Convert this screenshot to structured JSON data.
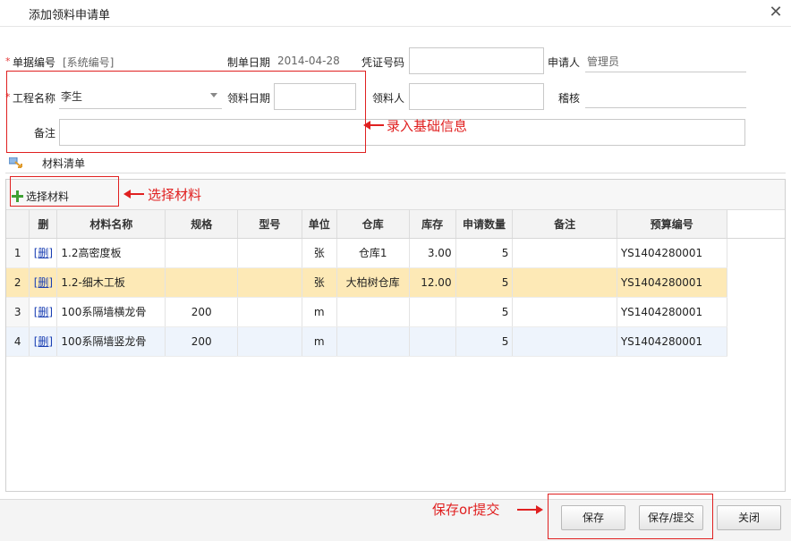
{
  "dialog": {
    "title": "添加领料申请单"
  },
  "form": {
    "doc_no": {
      "label": "单据编号",
      "value": "[系统编号]"
    },
    "date": {
      "label": "制单日期",
      "value": "2014-04-28"
    },
    "voucher": {
      "label": "凭证号码",
      "value": ""
    },
    "applicant": {
      "label": "申请人",
      "value": "管理员"
    },
    "project": {
      "label": "工程名称",
      "value": "李生"
    },
    "pick_date": {
      "label": "领料日期",
      "value": ""
    },
    "picker": {
      "label": "领料人",
      "value": ""
    },
    "audit": {
      "label": "稽核",
      "value": ""
    },
    "remark": {
      "label": "备注",
      "value": ""
    }
  },
  "annotations": {
    "basic_info": "录入基础信息",
    "select_material": "选择材料",
    "save_submit": "保存or提交"
  },
  "section": {
    "title": "材料清单"
  },
  "toolbar": {
    "select_material": "选择材料"
  },
  "table": {
    "columns": [
      "",
      "删",
      "材料名称",
      "规格",
      "型号",
      "单位",
      "仓库",
      "库存",
      "申请数量",
      "备注",
      "预算编号"
    ],
    "rows": [
      {
        "idx": "1",
        "del": "[删]",
        "name": "1.2高密度板",
        "spec": "",
        "model": "",
        "unit": "张",
        "warehouse": "仓库1",
        "stock": "3.00",
        "qty": "5",
        "remark": "",
        "budget": "YS1404280001"
      },
      {
        "idx": "2",
        "del": "[删]",
        "name": "1.2-细木工板",
        "spec": "",
        "model": "",
        "unit": "张",
        "warehouse": "大柏树仓库",
        "stock": "12.00",
        "qty": "5",
        "remark": "",
        "budget": "YS1404280001"
      },
      {
        "idx": "3",
        "del": "[删]",
        "name": "100系隔墙横龙骨",
        "spec": "200",
        "model": "",
        "unit": "m",
        "warehouse": "",
        "stock": "",
        "qty": "5",
        "remark": "",
        "budget": "YS1404280001"
      },
      {
        "idx": "4",
        "del": "[删]",
        "name": "100系隔墙竖龙骨",
        "spec": "200",
        "model": "",
        "unit": "m",
        "warehouse": "",
        "stock": "",
        "qty": "5",
        "remark": "",
        "budget": "YS1404280001"
      }
    ]
  },
  "buttons": {
    "save": "保存",
    "save_submit": "保存/提交",
    "close": "关闭"
  },
  "colors": {
    "annotation": "#e02020",
    "row_highlight": "#fde9b6",
    "row_alt": "#eef4fc",
    "delete_link": "#1a3fb3"
  }
}
